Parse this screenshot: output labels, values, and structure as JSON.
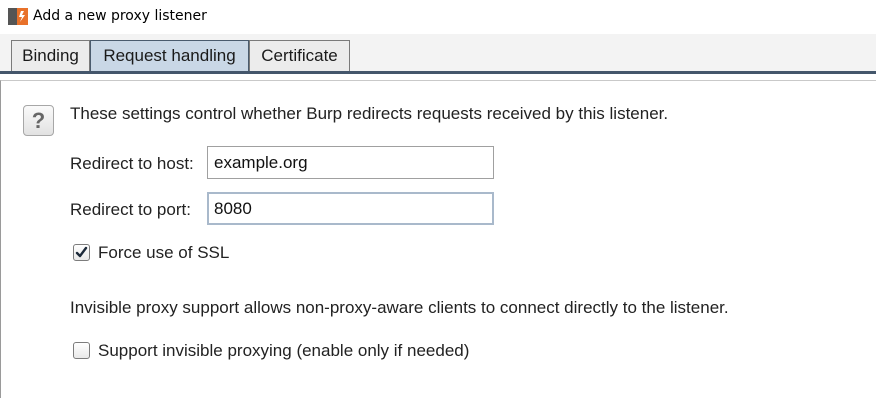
{
  "window": {
    "title": "Add a new proxy listener",
    "icon": "burp-icon"
  },
  "tabs": [
    {
      "label": "Binding",
      "selected": false
    },
    {
      "label": "Request handling",
      "selected": true
    },
    {
      "label": "Certificate",
      "selected": false
    }
  ],
  "panel": {
    "help_icon": "question-icon",
    "help_glyph": "?",
    "intro_text": "These settings control whether Burp redirects requests received by this listener.",
    "redirect_host_label": "Redirect to host:",
    "redirect_host_value": "example.org",
    "redirect_port_label": "Redirect to port:",
    "redirect_port_value": "8080",
    "force_ssl_label": "Force use of SSL",
    "force_ssl_checked": true,
    "invisible_text": "Invisible proxy support allows non-proxy-aware clients to connect directly to the listener.",
    "invisible_label": "Support invisible proxying (enable only if needed)",
    "invisible_checked": false
  },
  "colors": {
    "selected_tab": "#c9d7e6",
    "accent": "#e8712a"
  }
}
